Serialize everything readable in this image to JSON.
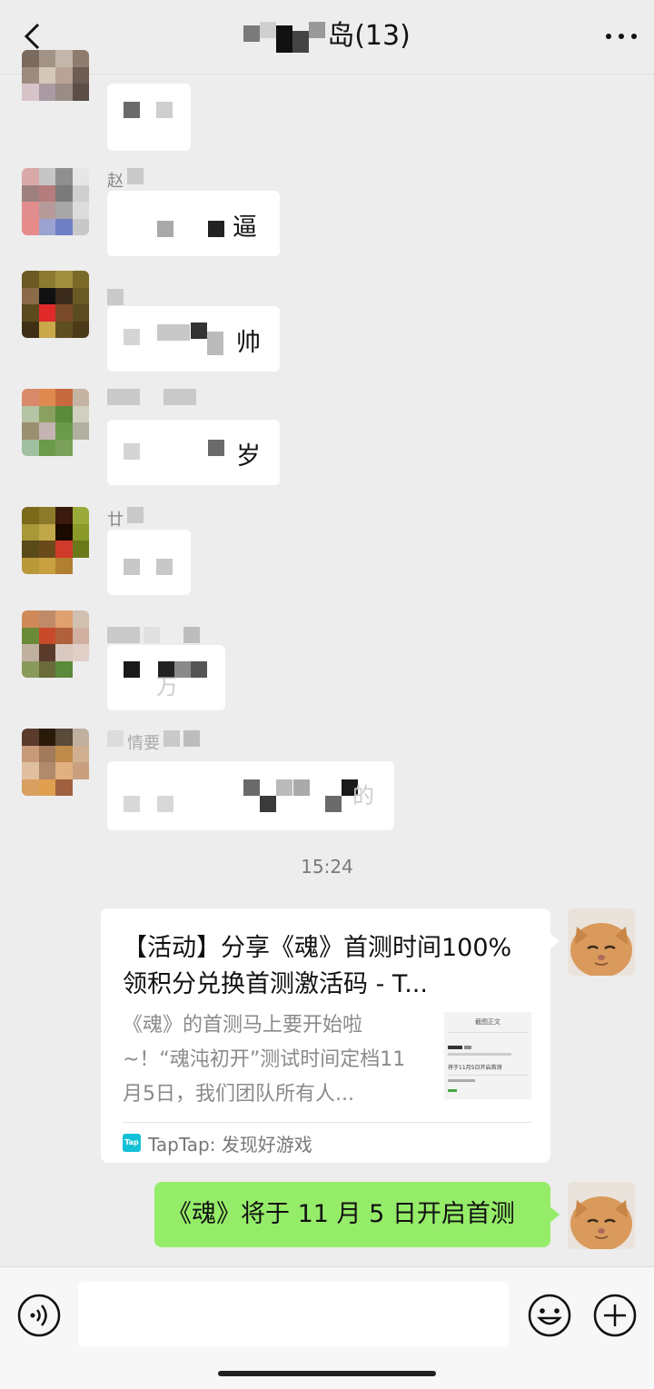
{
  "header": {
    "title_suffix": "岛(13)"
  },
  "messages": [
    {
      "text_tail": ""
    },
    {
      "nick_char": "赵",
      "text_tail": "逼"
    },
    {
      "text_tail": "帅"
    },
    {
      "text_tail": "岁"
    },
    {
      "nick_char": "廿",
      "text_tail": ""
    },
    {
      "text_tail": "万"
    },
    {
      "nick_char": "情要",
      "text_tail": "的"
    }
  ],
  "timestamp": "15:24",
  "link_card": {
    "title": "【活动】分享《魂》首测时间100%领积分兑换首测激活码 - T...",
    "description": "《魂》的首测马上要开始啦~！“魂沌初开”测试时间定档11月5日，我们团队所有人...",
    "thumbnail_heading": "截图正文",
    "thumbnail_line": "将于11月5日开启首测",
    "source_logo": "Tap",
    "source": "TapTap: 发现好游戏"
  },
  "my_message": "《魂》将于 11 月 5 日开启首测",
  "colors": {
    "background": "#ededed",
    "sent_bubble": "#95ec69",
    "received_bubble": "#ffffff",
    "tap_logo": "#14c0d6"
  },
  "icons": {
    "back": "chevron-left-icon",
    "more": "more-icon",
    "voice": "voice-icon",
    "emoji": "emoji-icon",
    "plus": "plus-icon"
  }
}
